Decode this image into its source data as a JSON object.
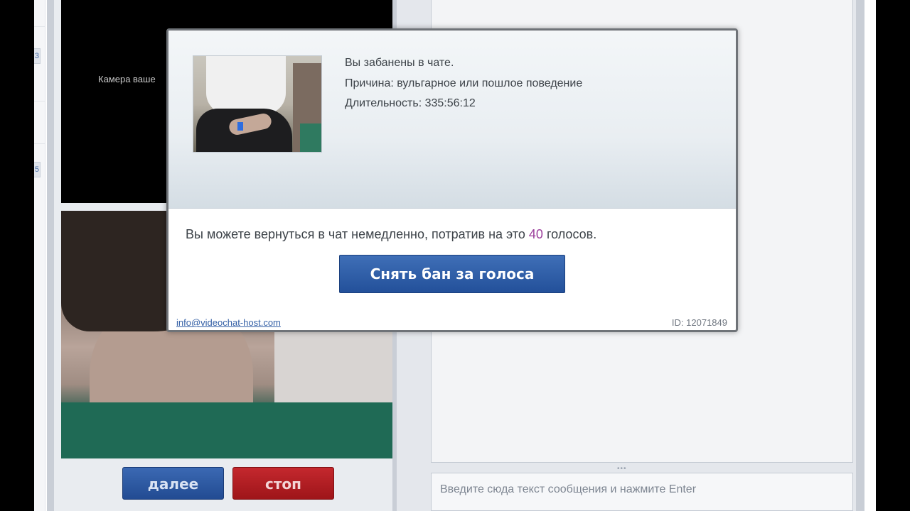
{
  "sidebar": {
    "tabs": [
      {
        "label": "3"
      },
      {
        "label": "5"
      }
    ]
  },
  "video": {
    "partner_status": "Камера ваше"
  },
  "controls": {
    "next_label": "далее",
    "stop_label": "стоп"
  },
  "chat": {
    "input_placeholder": "Введите сюда текст сообщения и нажмите Enter",
    "resize_handle": "•••"
  },
  "ban_dialog": {
    "line1": "Вы забанены в чате.",
    "reason_label": "Причина:",
    "reason_value": "вульгарное или пошлое поведение",
    "duration_label": "Длительность:",
    "duration_value": "335:56:12",
    "offer_prefix": "Вы можете вернуться в чат немедленно, потратив на это",
    "offer_votes": "40",
    "offer_suffix": "голосов.",
    "unban_button": "Снять бан за голоса",
    "contact_email": "info@videochat-host.com",
    "id_text": "ID: 12071849"
  },
  "colors": {
    "accent_blue": "#23509a",
    "stop_red": "#9e1519",
    "votes_purple": "#9b3d9b"
  }
}
